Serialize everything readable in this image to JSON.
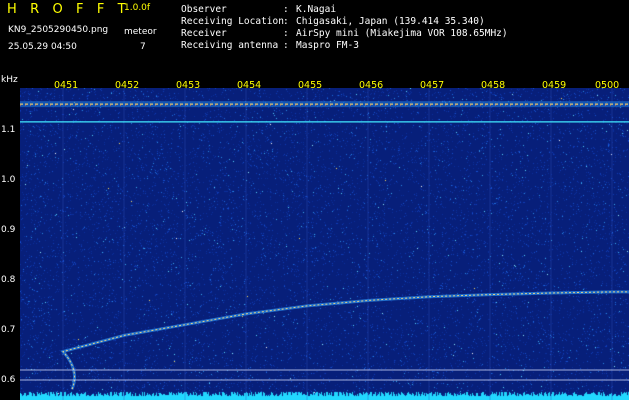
{
  "header": {
    "brand": "H R O F F T",
    "version": "1.0.0f",
    "filename": "KN9_2505290450.png",
    "mode": "meteor",
    "date": "25.05.29 04:50",
    "count": "7",
    "info": [
      {
        "key": "Observer",
        "value": "K.Nagai"
      },
      {
        "key": "Receiving Location",
        "value": "Chigasaki, Japan (139.414 35.340)"
      },
      {
        "key": "Receiver",
        "value": "AirSpy mini (Miakejima VOR 108.65MHz)"
      },
      {
        "key": "Receiving antenna",
        "value": "Maspro FM-3"
      }
    ]
  },
  "axis": {
    "unit": "kHz",
    "y_ticks": [
      "1.1",
      "1.0",
      "0.9",
      "0.8",
      "0.7",
      "0.6"
    ],
    "time_ticks": [
      "0451",
      "0452",
      "0453",
      "0454",
      "0455",
      "0456",
      "0457",
      "0458",
      "0459",
      "0500"
    ]
  },
  "colors": {
    "background": "#000000",
    "spectrogram_base": "#071f7a",
    "header_accent": "#ffff00",
    "text": "#ffffff",
    "floor_band": "#22d8ff"
  },
  "chart_data": {
    "type": "heatmap",
    "title": "",
    "xlabel": "",
    "ylabel": "kHz",
    "x": [
      "0451",
      "0452",
      "0453",
      "0454",
      "0455",
      "0456",
      "0457",
      "0458",
      "0459",
      "0500"
    ],
    "ylim": [
      0.58,
      1.16
    ],
    "series": [
      {
        "values": [
          1.13,
          1.13,
          1.13,
          1.13,
          1.13,
          1.13,
          1.13,
          1.13,
          1.13,
          1.13
        ]
      },
      {
        "values": [
          1.097,
          1.097,
          1.097,
          1.097,
          1.097,
          1.097,
          1.097,
          1.097,
          1.097,
          1.097
        ]
      },
      {
        "values": [
          0.67,
          0.7,
          0.72,
          0.74,
          0.755,
          0.765,
          0.772,
          0.776,
          0.779,
          0.781
        ]
      }
    ]
  }
}
